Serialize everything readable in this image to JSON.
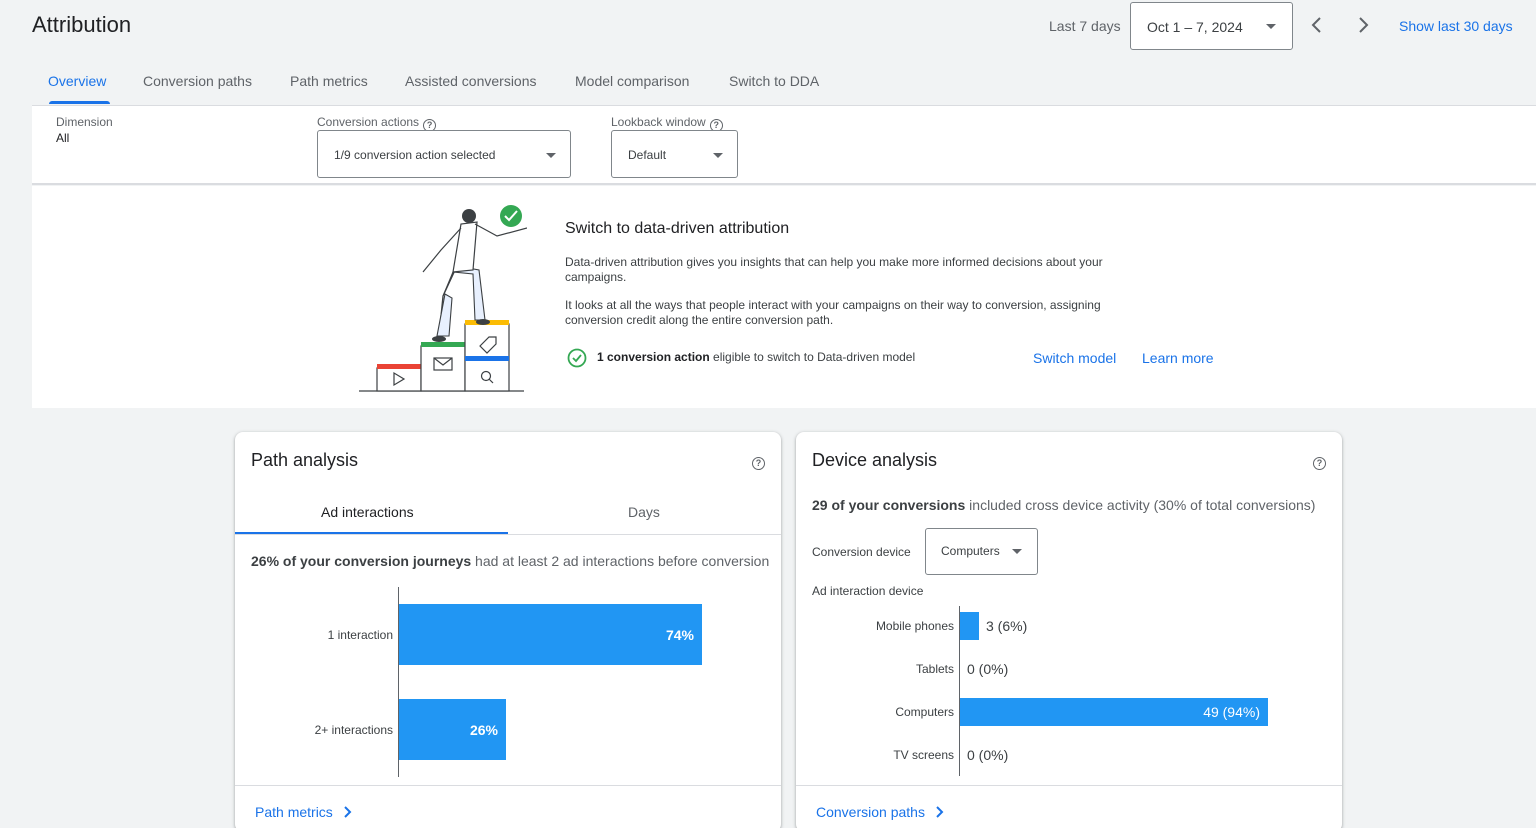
{
  "header": {
    "title": "Attribution",
    "range_label": "Last 7 days",
    "date_range": "Oct 1 – 7, 2024",
    "show_30": "Show last 30 days"
  },
  "tabs": [
    {
      "label": "Overview",
      "active": true
    },
    {
      "label": "Conversion paths"
    },
    {
      "label": "Path metrics"
    },
    {
      "label": "Assisted conversions"
    },
    {
      "label": "Model comparison"
    },
    {
      "label": "Switch to DDA"
    }
  ],
  "filters": {
    "dimension_label": "Dimension",
    "dimension_value": "All",
    "conversion_actions_label": "Conversion actions",
    "conversion_actions_value": "1/9 conversion action selected",
    "lookback_label": "Lookback window",
    "lookback_value": "Default"
  },
  "banner": {
    "title": "Switch to data-driven attribution",
    "para1": "Data-driven attribution gives you insights that can help you make more informed decisions about your campaigns.",
    "para2": "It looks at all the ways that people interact with your campaigns on their way to conversion, assigning conversion credit along the entire conversion path.",
    "eligible_bold": "1 conversion action",
    "eligible_rest": " eligible to switch to Data-driven model",
    "switch_model": "Switch model",
    "learn_more": "Learn more",
    "accent_colors": [
      "#ea4335",
      "#34a853",
      "#fbbc04",
      "#1a73e8"
    ]
  },
  "path_analysis": {
    "title": "Path analysis",
    "tab_interactions": "Ad interactions",
    "tab_days": "Days",
    "summary_bold": "26% of your conversion journeys",
    "summary_rest": " had at least 2 ad interactions before conversion",
    "footer_link": "Path metrics",
    "chart_data": {
      "type": "bar",
      "orientation": "horizontal",
      "categories": [
        "1 interaction",
        "2+ interactions"
      ],
      "values": [
        74,
        26
      ],
      "value_labels": [
        "74%",
        "26%"
      ],
      "unit": "%"
    }
  },
  "device_analysis": {
    "title": "Device analysis",
    "summary_bold": "29 of your conversions",
    "summary_rest": " included cross device activity (30% of total conversions)",
    "conversion_device_label": "Conversion device",
    "conversion_device_value": "Computers",
    "ad_interaction_label": "Ad interaction device",
    "footer_link": "Conversion paths",
    "chart_data": {
      "type": "bar",
      "orientation": "horizontal",
      "categories": [
        "Mobile phones",
        "Tablets",
        "Computers",
        "TV screens"
      ],
      "values": [
        3,
        0,
        49,
        0
      ],
      "value_labels": [
        "3 (6%)",
        "0 (0%)",
        "49 (94%)",
        "0 (0%)"
      ]
    }
  },
  "colors": {
    "accent": "#1a73e8",
    "bar": "#2196f3",
    "check": "#34a853"
  }
}
